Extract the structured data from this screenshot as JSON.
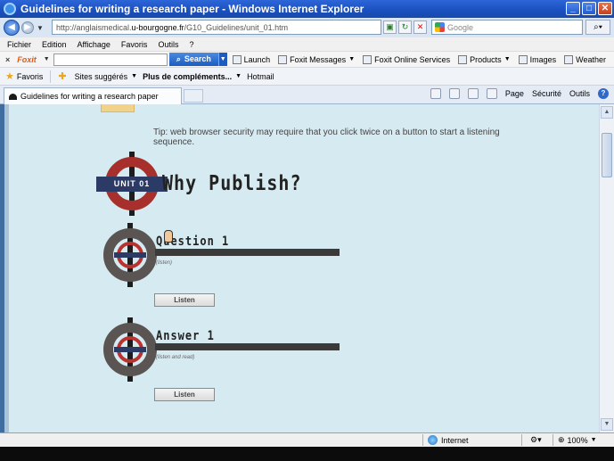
{
  "window": {
    "title": "Guidelines for writing a research paper - Windows Internet Explorer",
    "min_icon": "minimize-icon",
    "max_icon": "maximize-icon",
    "close_icon": "close-icon"
  },
  "address": {
    "url_prefix": "http://anglaismedical.",
    "url_domain": "u-bourgogne.fr",
    "url_path": "/G10_Guidelines/unit_01.htm",
    "search_placeholder": "Google"
  },
  "menu": [
    "Fichier",
    "Edition",
    "Affichage",
    "Favoris",
    "Outils",
    "?"
  ],
  "foxit": {
    "close": "×",
    "logo": "Foxit",
    "search_label": "Search",
    "items": [
      "Launch",
      "Foxit Messages",
      "Foxit Online Services",
      "Products",
      "Images",
      "Weather"
    ]
  },
  "favorites": {
    "favoris": "Favoris",
    "suggested": "Sites suggérés",
    "more": "Plus de compléments...",
    "hotmail": "Hotmail"
  },
  "tab": {
    "title": "Guidelines for writing a research paper"
  },
  "commandbar": {
    "page": "Page",
    "security": "Sécurité",
    "tools": "Outils"
  },
  "page": {
    "tip": "Tip: web browser security may require that you click twice on a button to start a listening sequence.",
    "unit_badge": "UNIT 01",
    "unit_title": "Why Publish?",
    "question_title": "Question 1",
    "question_sub": "(listen)",
    "question_button": "Listen",
    "answer_title": "Answer 1",
    "answer_sub": "(listen and read)",
    "answer_button": "Listen"
  },
  "status": {
    "zone": "Internet",
    "zoom": "100%"
  },
  "colors": {
    "content_bg": "#d6eaf1",
    "roundel_red": "#a8302c",
    "roundel_grey": "#5a5553",
    "roundel_bar": "#2b3b66"
  }
}
